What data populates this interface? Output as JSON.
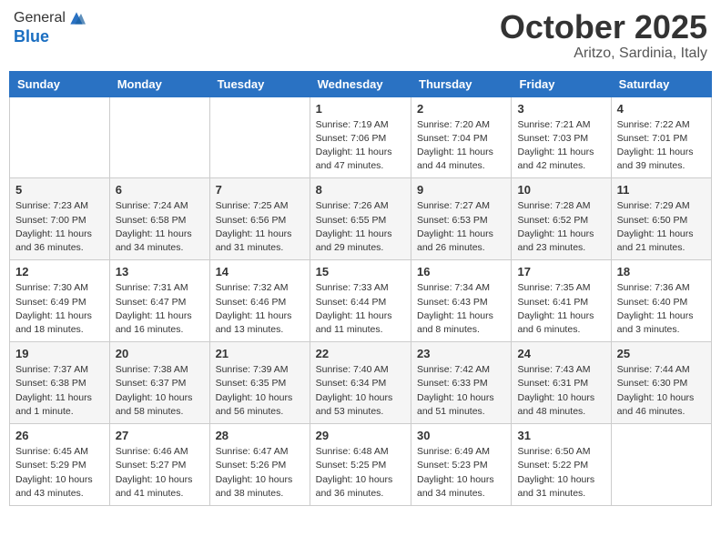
{
  "header": {
    "logo_line1": "General",
    "logo_line2": "Blue",
    "month": "October 2025",
    "location": "Aritzo, Sardinia, Italy"
  },
  "days_of_week": [
    "Sunday",
    "Monday",
    "Tuesday",
    "Wednesday",
    "Thursday",
    "Friday",
    "Saturday"
  ],
  "weeks": [
    [
      {
        "day": "",
        "info": ""
      },
      {
        "day": "",
        "info": ""
      },
      {
        "day": "",
        "info": ""
      },
      {
        "day": "1",
        "info": "Sunrise: 7:19 AM\nSunset: 7:06 PM\nDaylight: 11 hours and 47 minutes."
      },
      {
        "day": "2",
        "info": "Sunrise: 7:20 AM\nSunset: 7:04 PM\nDaylight: 11 hours and 44 minutes."
      },
      {
        "day": "3",
        "info": "Sunrise: 7:21 AM\nSunset: 7:03 PM\nDaylight: 11 hours and 42 minutes."
      },
      {
        "day": "4",
        "info": "Sunrise: 7:22 AM\nSunset: 7:01 PM\nDaylight: 11 hours and 39 minutes."
      }
    ],
    [
      {
        "day": "5",
        "info": "Sunrise: 7:23 AM\nSunset: 7:00 PM\nDaylight: 11 hours and 36 minutes."
      },
      {
        "day": "6",
        "info": "Sunrise: 7:24 AM\nSunset: 6:58 PM\nDaylight: 11 hours and 34 minutes."
      },
      {
        "day": "7",
        "info": "Sunrise: 7:25 AM\nSunset: 6:56 PM\nDaylight: 11 hours and 31 minutes."
      },
      {
        "day": "8",
        "info": "Sunrise: 7:26 AM\nSunset: 6:55 PM\nDaylight: 11 hours and 29 minutes."
      },
      {
        "day": "9",
        "info": "Sunrise: 7:27 AM\nSunset: 6:53 PM\nDaylight: 11 hours and 26 minutes."
      },
      {
        "day": "10",
        "info": "Sunrise: 7:28 AM\nSunset: 6:52 PM\nDaylight: 11 hours and 23 minutes."
      },
      {
        "day": "11",
        "info": "Sunrise: 7:29 AM\nSunset: 6:50 PM\nDaylight: 11 hours and 21 minutes."
      }
    ],
    [
      {
        "day": "12",
        "info": "Sunrise: 7:30 AM\nSunset: 6:49 PM\nDaylight: 11 hours and 18 minutes."
      },
      {
        "day": "13",
        "info": "Sunrise: 7:31 AM\nSunset: 6:47 PM\nDaylight: 11 hours and 16 minutes."
      },
      {
        "day": "14",
        "info": "Sunrise: 7:32 AM\nSunset: 6:46 PM\nDaylight: 11 hours and 13 minutes."
      },
      {
        "day": "15",
        "info": "Sunrise: 7:33 AM\nSunset: 6:44 PM\nDaylight: 11 hours and 11 minutes."
      },
      {
        "day": "16",
        "info": "Sunrise: 7:34 AM\nSunset: 6:43 PM\nDaylight: 11 hours and 8 minutes."
      },
      {
        "day": "17",
        "info": "Sunrise: 7:35 AM\nSunset: 6:41 PM\nDaylight: 11 hours and 6 minutes."
      },
      {
        "day": "18",
        "info": "Sunrise: 7:36 AM\nSunset: 6:40 PM\nDaylight: 11 hours and 3 minutes."
      }
    ],
    [
      {
        "day": "19",
        "info": "Sunrise: 7:37 AM\nSunset: 6:38 PM\nDaylight: 11 hours and 1 minute."
      },
      {
        "day": "20",
        "info": "Sunrise: 7:38 AM\nSunset: 6:37 PM\nDaylight: 10 hours and 58 minutes."
      },
      {
        "day": "21",
        "info": "Sunrise: 7:39 AM\nSunset: 6:35 PM\nDaylight: 10 hours and 56 minutes."
      },
      {
        "day": "22",
        "info": "Sunrise: 7:40 AM\nSunset: 6:34 PM\nDaylight: 10 hours and 53 minutes."
      },
      {
        "day": "23",
        "info": "Sunrise: 7:42 AM\nSunset: 6:33 PM\nDaylight: 10 hours and 51 minutes."
      },
      {
        "day": "24",
        "info": "Sunrise: 7:43 AM\nSunset: 6:31 PM\nDaylight: 10 hours and 48 minutes."
      },
      {
        "day": "25",
        "info": "Sunrise: 7:44 AM\nSunset: 6:30 PM\nDaylight: 10 hours and 46 minutes."
      }
    ],
    [
      {
        "day": "26",
        "info": "Sunrise: 6:45 AM\nSunset: 5:29 PM\nDaylight: 10 hours and 43 minutes."
      },
      {
        "day": "27",
        "info": "Sunrise: 6:46 AM\nSunset: 5:27 PM\nDaylight: 10 hours and 41 minutes."
      },
      {
        "day": "28",
        "info": "Sunrise: 6:47 AM\nSunset: 5:26 PM\nDaylight: 10 hours and 38 minutes."
      },
      {
        "day": "29",
        "info": "Sunrise: 6:48 AM\nSunset: 5:25 PM\nDaylight: 10 hours and 36 minutes."
      },
      {
        "day": "30",
        "info": "Sunrise: 6:49 AM\nSunset: 5:23 PM\nDaylight: 10 hours and 34 minutes."
      },
      {
        "day": "31",
        "info": "Sunrise: 6:50 AM\nSunset: 5:22 PM\nDaylight: 10 hours and 31 minutes."
      },
      {
        "day": "",
        "info": ""
      }
    ]
  ]
}
